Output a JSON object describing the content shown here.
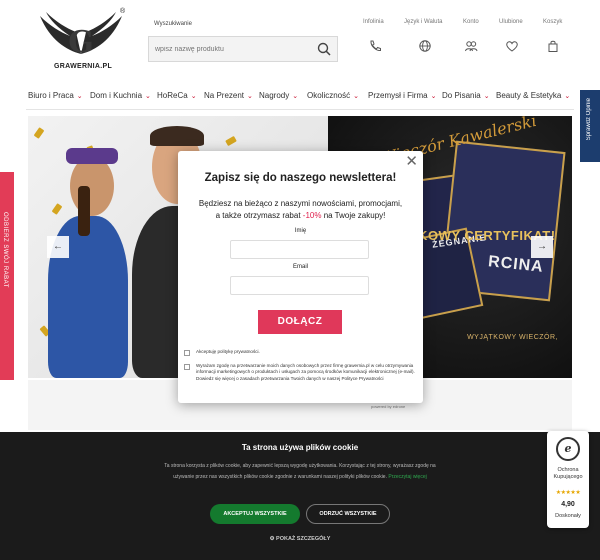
{
  "logo": {
    "text": "GRAWERNIA.PL",
    "reg": "®",
    "letter": "G"
  },
  "search": {
    "label": "Wyszukiwanie",
    "placeholder": "wpisz nazwę produktu"
  },
  "top_links": [
    "Infolinia",
    "Język i Waluta",
    "Konto",
    "Ulubione",
    "Koszyk"
  ],
  "nav": [
    "Biuro i Praca",
    "Dom i Kuchnia",
    "HoReCa",
    "Na Prezent",
    "Nagrody",
    "Okoliczność",
    "Przemysł i Firma",
    "Do Pisania",
    "Beauty & Estetyka"
  ],
  "side_rabat": "ODBIERZ SWÓJ RABAT",
  "side_opinie": "Sprawdź Opinie",
  "banner": {
    "script_text": "Wieczór Kawalerski",
    "cert_word_1": "ŻEGNANIE",
    "cert_word_2": "RCINA",
    "tagline": "WYJĄTKOWY WIECZÓR,",
    "cert_line": "JĄTKOWY CERTYFIKAT!",
    "prev": "←",
    "next": "→"
  },
  "powered": "powered by edrone",
  "modal": {
    "close": "✕",
    "title": "Zapisz się do naszego newslettera!",
    "desc_1": "Będziesz na bieżąco z naszymi nowościami, promocjami,",
    "desc_2a": "a także otrzymasz rabat ",
    "desc_pct": "-10%",
    "desc_2b": " na Twoje zakupy!",
    "name_label": "Imię",
    "email_label": "Email",
    "button": "DOŁĄCZ",
    "consent_1": "Akceptuję politykę prywatności.",
    "consent_2": "Wyrażam zgodę na przetwarzanie moich danych osobowych przez firmę grawernia.pl w celu otrzymywania informacji marketingowych o produktach i usługach za pomocą środków komunikacji elektronicznej (e-mail). Dowiedz się więcej o zasadach przetwarzania Twoich danych w naszej Polityce Prywatności"
  },
  "cookie": {
    "title": "Ta strona używa plików cookie",
    "text": "Ta strona korzysta z plików cookie, aby zapewnić lepszą wygodę użytkowania. Korzystając z tej strony, wyrażasz zgodę na używanie przez nas wszystkich plików cookie zgodnie z warunkami naszej polityki plików cookie.",
    "link": "Przeczytaj więcej",
    "accept": "AKCEPTUJ WSZYSTKIE",
    "reject": "ODRZUĆ WSZYSTKIE",
    "details": "POKAŻ SZCZEGÓŁY"
  },
  "trust": {
    "seal": "e",
    "label": "Ochrona Kupującego",
    "stars": "★★★★★",
    "score": "4,90",
    "rating": "Doskonały"
  }
}
